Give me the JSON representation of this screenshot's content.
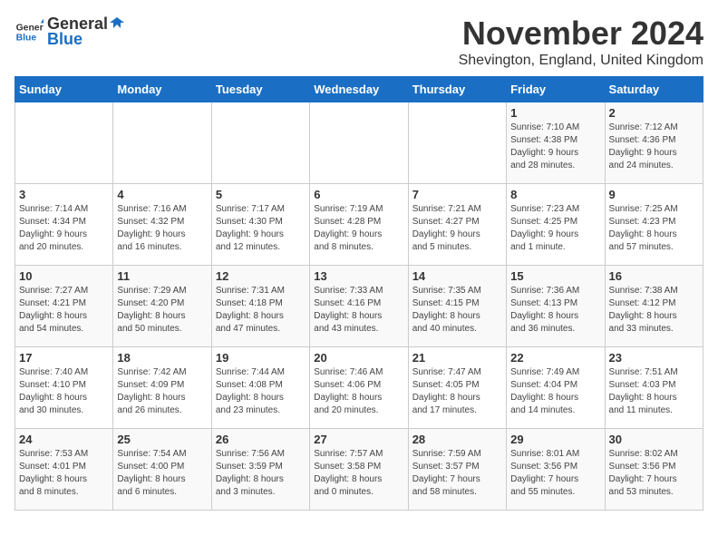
{
  "logo": {
    "general": "General",
    "blue": "Blue"
  },
  "title": "November 2024",
  "subtitle": "Shevington, England, United Kingdom",
  "headers": [
    "Sunday",
    "Monday",
    "Tuesday",
    "Wednesday",
    "Thursday",
    "Friday",
    "Saturday"
  ],
  "weeks": [
    [
      {
        "day": "",
        "info": ""
      },
      {
        "day": "",
        "info": ""
      },
      {
        "day": "",
        "info": ""
      },
      {
        "day": "",
        "info": ""
      },
      {
        "day": "",
        "info": ""
      },
      {
        "day": "1",
        "info": "Sunrise: 7:10 AM\nSunset: 4:38 PM\nDaylight: 9 hours\nand 28 minutes."
      },
      {
        "day": "2",
        "info": "Sunrise: 7:12 AM\nSunset: 4:36 PM\nDaylight: 9 hours\nand 24 minutes."
      }
    ],
    [
      {
        "day": "3",
        "info": "Sunrise: 7:14 AM\nSunset: 4:34 PM\nDaylight: 9 hours\nand 20 minutes."
      },
      {
        "day": "4",
        "info": "Sunrise: 7:16 AM\nSunset: 4:32 PM\nDaylight: 9 hours\nand 16 minutes."
      },
      {
        "day": "5",
        "info": "Sunrise: 7:17 AM\nSunset: 4:30 PM\nDaylight: 9 hours\nand 12 minutes."
      },
      {
        "day": "6",
        "info": "Sunrise: 7:19 AM\nSunset: 4:28 PM\nDaylight: 9 hours\nand 8 minutes."
      },
      {
        "day": "7",
        "info": "Sunrise: 7:21 AM\nSunset: 4:27 PM\nDaylight: 9 hours\nand 5 minutes."
      },
      {
        "day": "8",
        "info": "Sunrise: 7:23 AM\nSunset: 4:25 PM\nDaylight: 9 hours\nand 1 minute."
      },
      {
        "day": "9",
        "info": "Sunrise: 7:25 AM\nSunset: 4:23 PM\nDaylight: 8 hours\nand 57 minutes."
      }
    ],
    [
      {
        "day": "10",
        "info": "Sunrise: 7:27 AM\nSunset: 4:21 PM\nDaylight: 8 hours\nand 54 minutes."
      },
      {
        "day": "11",
        "info": "Sunrise: 7:29 AM\nSunset: 4:20 PM\nDaylight: 8 hours\nand 50 minutes."
      },
      {
        "day": "12",
        "info": "Sunrise: 7:31 AM\nSunset: 4:18 PM\nDaylight: 8 hours\nand 47 minutes."
      },
      {
        "day": "13",
        "info": "Sunrise: 7:33 AM\nSunset: 4:16 PM\nDaylight: 8 hours\nand 43 minutes."
      },
      {
        "day": "14",
        "info": "Sunrise: 7:35 AM\nSunset: 4:15 PM\nDaylight: 8 hours\nand 40 minutes."
      },
      {
        "day": "15",
        "info": "Sunrise: 7:36 AM\nSunset: 4:13 PM\nDaylight: 8 hours\nand 36 minutes."
      },
      {
        "day": "16",
        "info": "Sunrise: 7:38 AM\nSunset: 4:12 PM\nDaylight: 8 hours\nand 33 minutes."
      }
    ],
    [
      {
        "day": "17",
        "info": "Sunrise: 7:40 AM\nSunset: 4:10 PM\nDaylight: 8 hours\nand 30 minutes."
      },
      {
        "day": "18",
        "info": "Sunrise: 7:42 AM\nSunset: 4:09 PM\nDaylight: 8 hours\nand 26 minutes."
      },
      {
        "day": "19",
        "info": "Sunrise: 7:44 AM\nSunset: 4:08 PM\nDaylight: 8 hours\nand 23 minutes."
      },
      {
        "day": "20",
        "info": "Sunrise: 7:46 AM\nSunset: 4:06 PM\nDaylight: 8 hours\nand 20 minutes."
      },
      {
        "day": "21",
        "info": "Sunrise: 7:47 AM\nSunset: 4:05 PM\nDaylight: 8 hours\nand 17 minutes."
      },
      {
        "day": "22",
        "info": "Sunrise: 7:49 AM\nSunset: 4:04 PM\nDaylight: 8 hours\nand 14 minutes."
      },
      {
        "day": "23",
        "info": "Sunrise: 7:51 AM\nSunset: 4:03 PM\nDaylight: 8 hours\nand 11 minutes."
      }
    ],
    [
      {
        "day": "24",
        "info": "Sunrise: 7:53 AM\nSunset: 4:01 PM\nDaylight: 8 hours\nand 8 minutes."
      },
      {
        "day": "25",
        "info": "Sunrise: 7:54 AM\nSunset: 4:00 PM\nDaylight: 8 hours\nand 6 minutes."
      },
      {
        "day": "26",
        "info": "Sunrise: 7:56 AM\nSunset: 3:59 PM\nDaylight: 8 hours\nand 3 minutes."
      },
      {
        "day": "27",
        "info": "Sunrise: 7:57 AM\nSunset: 3:58 PM\nDaylight: 8 hours\nand 0 minutes."
      },
      {
        "day": "28",
        "info": "Sunrise: 7:59 AM\nSunset: 3:57 PM\nDaylight: 7 hours\nand 58 minutes."
      },
      {
        "day": "29",
        "info": "Sunrise: 8:01 AM\nSunset: 3:56 PM\nDaylight: 7 hours\nand 55 minutes."
      },
      {
        "day": "30",
        "info": "Sunrise: 8:02 AM\nSunset: 3:56 PM\nDaylight: 7 hours\nand 53 minutes."
      }
    ]
  ]
}
